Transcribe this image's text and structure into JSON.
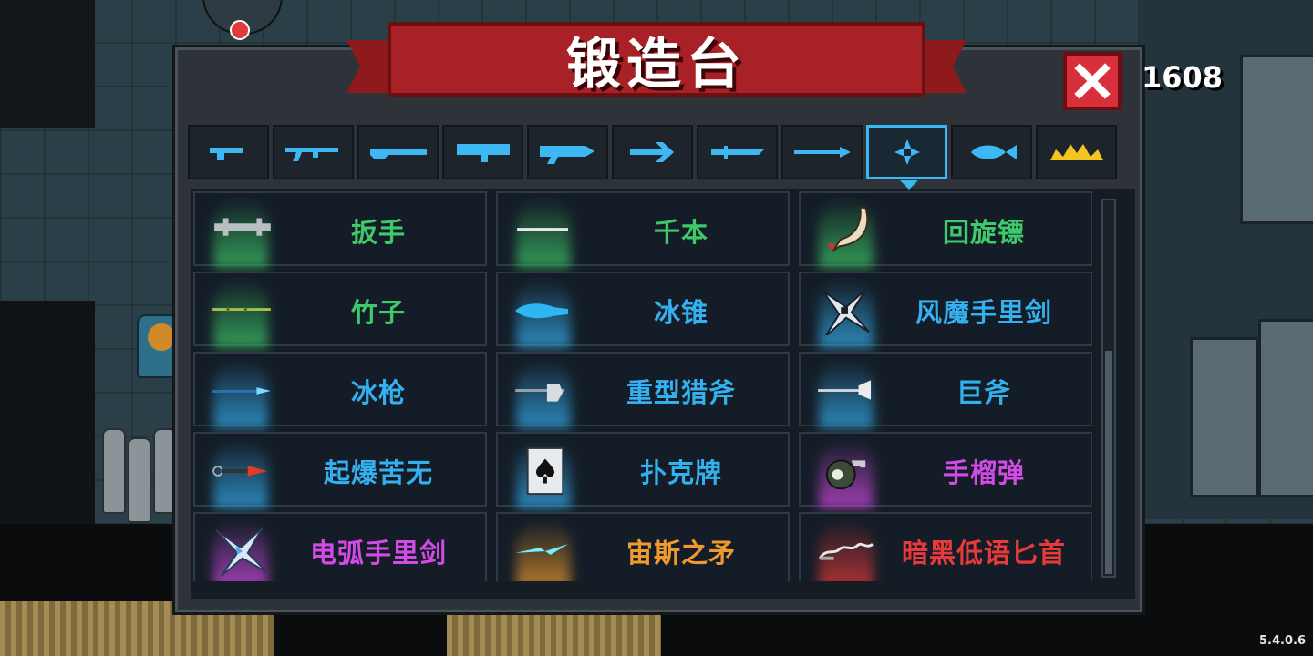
{
  "title": "锻造台",
  "coin_count": "1608",
  "version": "5.4.0.6",
  "colors": {
    "green": "#3ec96a",
    "blue": "#35b0ef",
    "purple": "#d34be6",
    "orange": "#ee9a2e",
    "red": "#e83a3a",
    "tab_active": "#38b9f0"
  },
  "tabs": [
    {
      "icon": "pistol-icon",
      "active": false
    },
    {
      "icon": "rifle-icon",
      "active": false
    },
    {
      "icon": "shotgun-icon",
      "active": false
    },
    {
      "icon": "launcher-icon",
      "active": false
    },
    {
      "icon": "laser-gun-icon",
      "active": false
    },
    {
      "icon": "bow-icon",
      "active": false
    },
    {
      "icon": "sword-icon",
      "active": false
    },
    {
      "icon": "spear-icon",
      "active": false
    },
    {
      "icon": "throwing-star-icon",
      "active": true
    },
    {
      "icon": "fish-icon",
      "active": false
    },
    {
      "icon": "crown-icon",
      "active": false
    }
  ],
  "items": [
    {
      "name": "扳手",
      "rarity": "green",
      "icon": "wrench-icon"
    },
    {
      "name": "千本",
      "rarity": "green",
      "icon": "needle-icon"
    },
    {
      "name": "回旋镖",
      "rarity": "green",
      "icon": "boomerang-icon"
    },
    {
      "name": "竹子",
      "rarity": "green",
      "icon": "bamboo-icon"
    },
    {
      "name": "冰锥",
      "rarity": "blue",
      "icon": "icicle-icon"
    },
    {
      "name": "风魔手里剑",
      "rarity": "blue",
      "icon": "fuma-shuriken-icon"
    },
    {
      "name": "冰枪",
      "rarity": "blue",
      "icon": "ice-spear-icon"
    },
    {
      "name": "重型猎斧",
      "rarity": "blue",
      "icon": "heavy-axe-icon"
    },
    {
      "name": "巨斧",
      "rarity": "blue",
      "icon": "giant-axe-icon"
    },
    {
      "name": "起爆苦无",
      "rarity": "blue",
      "icon": "kunai-icon"
    },
    {
      "name": "扑克牌",
      "rarity": "blue",
      "icon": "playing-card-icon"
    },
    {
      "name": "手榴弹",
      "rarity": "purple",
      "icon": "grenade-icon"
    },
    {
      "name": "电弧手里剑",
      "rarity": "purple",
      "icon": "arc-shuriken-icon"
    },
    {
      "name": "宙斯之矛",
      "rarity": "orange",
      "icon": "zeus-spear-icon"
    },
    {
      "name": "暗黑低语匕首",
      "rarity": "red",
      "icon": "dark-dagger-icon"
    }
  ]
}
